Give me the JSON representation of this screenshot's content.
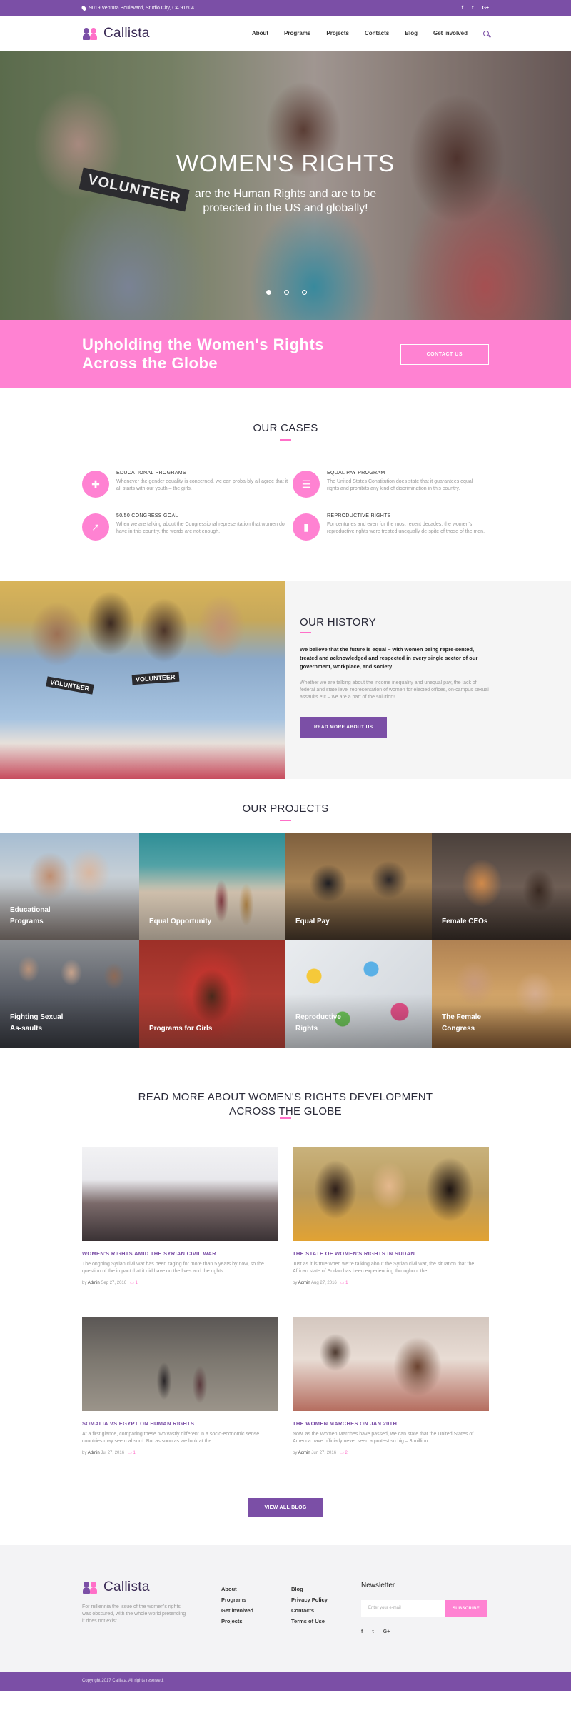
{
  "topbar": {
    "address": "9019 Ventura Boulevard, Studio City, CA 91604",
    "social": [
      "f",
      "t",
      "G+"
    ]
  },
  "header": {
    "brand": "Callista",
    "nav": [
      "About",
      "Programs",
      "Projects",
      "Contacts",
      "Blog",
      "Get involved"
    ]
  },
  "hero": {
    "title": "WOMEN'S RIGHTS",
    "subtitle": "are the Human Rights and are to be protected in the US and globally!",
    "photo_tag": "VOLUNTEER"
  },
  "cta": {
    "headline": "Upholding the Women's Rights Across the Globe",
    "button": "CONTACT US"
  },
  "cases": {
    "title": "OUR CASES",
    "items": [
      {
        "title": "EDUCATIONAL PROGRAMS",
        "text": "Whenever the gender equality is concerned, we can proba-bly all agree that it all starts with our youth – the girls.",
        "icon": "puzzle-icon"
      },
      {
        "title": "EQUAL PAY PROGRAM",
        "text": "The United States Constitution does state that it guarantees equal rights and prohibits any kind of discrimination in this country.",
        "icon": "list-icon"
      },
      {
        "title": "50/50 CONGRESS GOAL",
        "text": "When we are talking about the Congressional representation that women do have in this country, the words are not enough.",
        "icon": "trend-icon"
      },
      {
        "title": "REPRODUCTIVE RIGHTS",
        "text": "For centuries and even for the most recent decades, the women's reproductive rights were treated unequally de-spite of those of the men.",
        "icon": "bar-chart-icon"
      }
    ]
  },
  "history": {
    "title": "OUR HISTORY",
    "lead": "We believe that the future is equal – with women being repre-sented, treated and acknowledged and respected in every single sector of our government, workplace, and society!",
    "body": "Whether we are talking about the income inequality and unequal pay, the lack of federal and state level representation of women for elected offices, on-campus sexual assaults etc – we are a part of the solution!",
    "button": "READ MORE ABOUT US",
    "photo_tag": "VOLUNTEER"
  },
  "projects": {
    "title": "OUR PROJECTS",
    "items": [
      "Educational Programs",
      "Equal Opportunity",
      "Equal Pay",
      "Female CEOs",
      "Fighting Sexual As-saults",
      "Programs for Girls",
      "Reproductive Rights",
      "The Female Congress"
    ]
  },
  "blog": {
    "title_line1": "READ MORE ABOUT WOMEN'S RIGHTS DEVELOPMENT",
    "title_line2": "ACROSS THE GLOBE",
    "posts": [
      {
        "title": "WOMEN'S RIGHTS AMID THE SYRIAN CIVIL WAR",
        "excerpt": "The ongoing Syrian civil war has been raging for more than 5 years by now, so the question of the impact that it did have on the lives and the rights...",
        "author": "Admin",
        "date": "Sep 27, 2016",
        "comments": "1"
      },
      {
        "title": "THE STATE OF WOMEN'S RIGHTS IN SUDAN",
        "excerpt": "Just as it is true when we're talking about the Syrian civil war, the situation that the African state of Sudan has been experiencing throughout the...",
        "author": "Admin",
        "date": "Aug 27, 2016",
        "comments": "1"
      },
      {
        "title": "SOMALIA VS EGYPT ON HUMAN RIGHTS",
        "excerpt": "At a first glance, comparing these two vastly different in a socio-economic sense countries may seem absurd. But as soon as we look at the...",
        "author": "Admin",
        "date": "Jul 27, 2016",
        "comments": "1"
      },
      {
        "title": "THE WOMEN MARCHES ON JAN 20TH",
        "excerpt": "Now, as the Women Marches have passed, we can state that the United States of America have officially never seen a protest so big – 3 million...",
        "author": "Admin",
        "date": "Jun 27, 2016",
        "comments": "2"
      }
    ],
    "by": "by",
    "button": "VIEW ALL BLOG"
  },
  "footer": {
    "brand": "Callista",
    "about": "For millennia the issue of the women's rights was obscured, with the whole world pretending it does not exist.",
    "col1": [
      "About",
      "Programs",
      "Get involved",
      "Projects"
    ],
    "col2": [
      "Blog",
      "Privacy Policy",
      "Contacts",
      "Terms of Use"
    ],
    "newsletter_title": "Newsletter",
    "email_placeholder": "Enter your e-mail",
    "subscribe": "SUBSCRIBE",
    "social": [
      "f",
      "t",
      "G+"
    ],
    "copyright": "Copyright 2017 Callista. All rights reserved."
  },
  "colors": {
    "purple": "#7b4fa6",
    "pink": "#ff82d2"
  }
}
